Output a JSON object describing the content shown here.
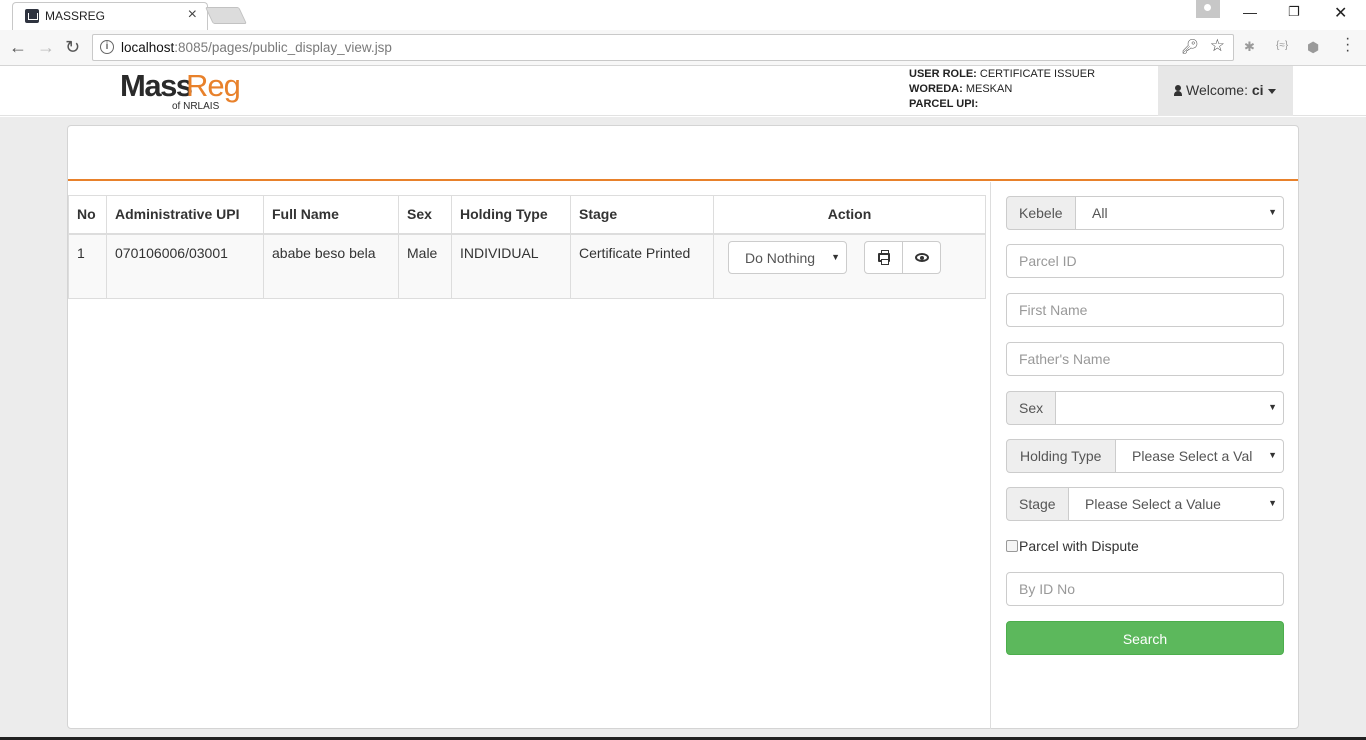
{
  "browser": {
    "tab_title": "MASSREG",
    "url_host": "localhost",
    "url_path": ":8085/pages/public_display_view.jsp"
  },
  "header": {
    "logo_mass": "Mass",
    "logo_reg": "Reg",
    "logo_sub": "of NRLAIS",
    "user_role_label": "USER ROLE:",
    "user_role_value": "CERTIFICATE ISSUER",
    "woreda_label": "WOREDA:",
    "woreda_value": "MESKAN",
    "parcel_upi_label": "PARCEL UPI:",
    "parcel_upi_value": "",
    "welcome_label": "Welcome:",
    "welcome_user": "ci"
  },
  "table": {
    "columns": [
      "No",
      "Administrative UPI",
      "Full Name",
      "Sex",
      "Holding Type",
      "Stage",
      "Action"
    ],
    "rows": [
      {
        "no": "1",
        "upi": "070106006/03001",
        "full_name": "ababe beso bela",
        "sex": "Male",
        "holding_type": "INDIVIDUAL",
        "stage": "Certificate Printed",
        "action_selected": "Do Nothing"
      }
    ]
  },
  "filters": {
    "kebele_label": "Kebele",
    "kebele_value": "All",
    "parcel_id_placeholder": "Parcel ID",
    "first_name_placeholder": "First Name",
    "fathers_name_placeholder": "Father's Name",
    "sex_label": "Sex",
    "sex_value": "",
    "holding_type_label": "Holding Type",
    "holding_type_value": "Please Select a Val",
    "stage_label": "Stage",
    "stage_value": "Please Select a Value",
    "dispute_label": "Parcel with Dispute",
    "id_no_placeholder": "By ID No",
    "search_label": "Search"
  },
  "colors": {
    "accent": "#e8812b",
    "search_button": "#5cb85c"
  }
}
